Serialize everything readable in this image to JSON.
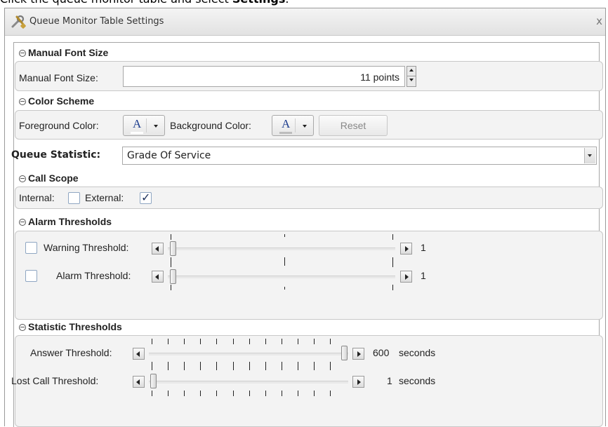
{
  "instruction": {
    "prefix": "Click the queue monitor table and select ",
    "bold": "Settings",
    "suffix": "."
  },
  "dialog": {
    "title": "Queue Monitor Table Settings",
    "close_label": "x"
  },
  "manual_font_size": {
    "header": "Manual Font Size",
    "label": "Manual Font Size:",
    "value": "11 points"
  },
  "color_scheme": {
    "header": "Color Scheme",
    "foreground_label": "Foreground Color:",
    "background_label": "Background Color:",
    "glyph": "A",
    "foreground_underline_color": "#ffffff",
    "background_underline_color": "#bdbdbd",
    "reset_label": "Reset"
  },
  "queue_statistic": {
    "label": "Queue Statistic:",
    "selected": "Grade Of Service"
  },
  "call_scope": {
    "header": "Call Scope",
    "internal_label": "Internal:",
    "external_label": "External:",
    "internal_checked": false,
    "external_checked": true,
    "check_glyph": "✓"
  },
  "alarm_thresholds": {
    "header": "Alarm Thresholds",
    "warning_label": "Warning Threshold:",
    "warning_value": "1",
    "alarm_label": "Alarm Threshold:",
    "alarm_value": "1"
  },
  "statistic_thresholds": {
    "header": "Statistic Thresholds",
    "answer_label": "Answer Threshold:",
    "answer_value": "600",
    "answer_unit": "seconds",
    "lost_label": "Lost Call Threshold:",
    "lost_value": "1",
    "lost_unit": "seconds"
  }
}
